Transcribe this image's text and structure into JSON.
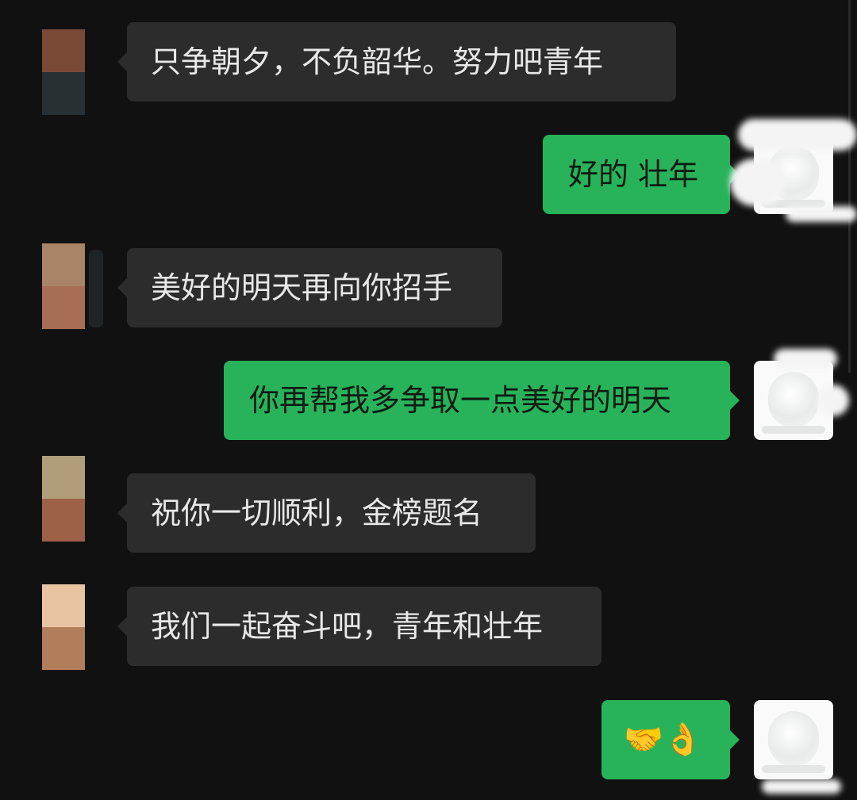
{
  "messages": [
    {
      "side": "in",
      "text": "只争朝夕，不负韶华。努力吧青年"
    },
    {
      "side": "out",
      "text": "好的 壮年"
    },
    {
      "side": "in",
      "text": "美好的明天再向你招手"
    },
    {
      "side": "out",
      "text": "你再帮我多争取一点美好的明天"
    },
    {
      "side": "in",
      "text": "祝你一切顺利，金榜题名"
    },
    {
      "side": "in",
      "text": "我们一起奋斗吧，青年和壮年"
    },
    {
      "side": "out",
      "text": "🤝👌"
    }
  ],
  "colors": {
    "background": "#111111",
    "incoming_bubble": "#2c2c2c",
    "outgoing_bubble": "#28b35a"
  }
}
